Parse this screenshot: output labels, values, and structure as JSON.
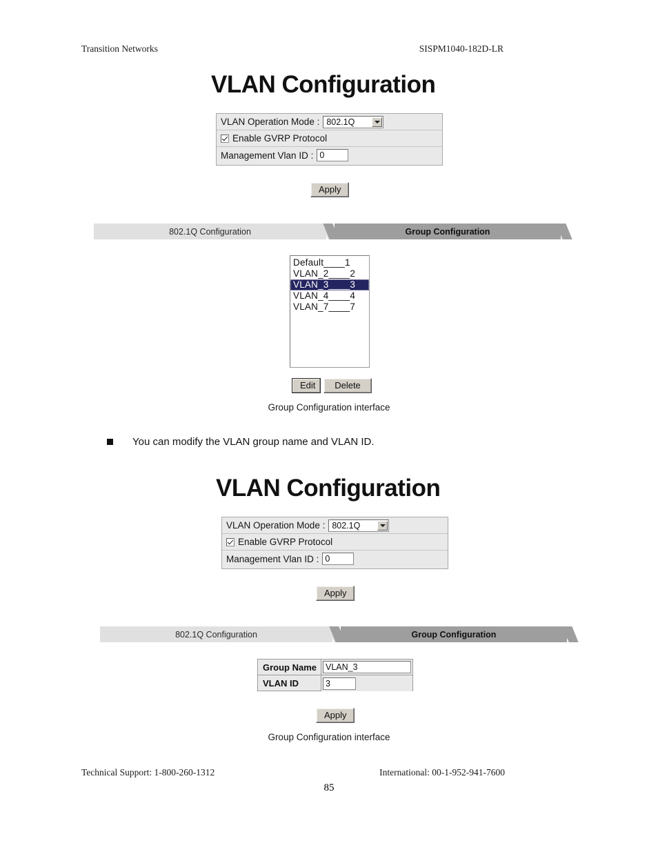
{
  "page": {
    "header_left": "Transition Networks",
    "header_right": "SISPM1040-182D-LR",
    "footer_left": "Technical Support: 1-800-260-1312",
    "footer_right": "International: 00-1-952-941-7600",
    "page_number": "85"
  },
  "note": {
    "bullet_text": "You can modify the VLAN group name and VLAN ID."
  },
  "screen1": {
    "title": "VLAN Configuration",
    "panel": {
      "mode_label": "VLAN Operation Mode :",
      "mode_value": "802.1Q",
      "gvrp_label": "Enable GVRP Protocol",
      "gvrp_checked": true,
      "mgmt_label": "Management Vlan ID :",
      "mgmt_value": "0"
    },
    "apply_label": "Apply",
    "tabs": [
      {
        "label": "802.1Q Configuration",
        "active": false
      },
      {
        "label": "Group Configuration",
        "active": true
      }
    ],
    "group_list": [
      {
        "text": "Default____1",
        "selected": false
      },
      {
        "text": "VLAN_2____2",
        "selected": false
      },
      {
        "text": "VLAN_3____3",
        "selected": true
      },
      {
        "text": "VLAN_4____4",
        "selected": false
      },
      {
        "text": "VLAN_7____7",
        "selected": false
      }
    ],
    "edit_label": "Edit",
    "delete_label": "Delete",
    "caption": "Group Configuration interface"
  },
  "screen2": {
    "title": "VLAN Configuration",
    "panel": {
      "mode_label": "VLAN Operation Mode :",
      "mode_value": "802.1Q",
      "gvrp_label": "Enable GVRP Protocol",
      "gvrp_checked": true,
      "mgmt_label": "Management Vlan ID :",
      "mgmt_value": "0"
    },
    "apply_label": "Apply",
    "tabs": [
      {
        "label": "802.1Q Configuration",
        "active": false
      },
      {
        "label": "Group Configuration",
        "active": true
      }
    ],
    "form": {
      "group_name_label": "Group Name",
      "group_name_value": "VLAN_3",
      "vlan_id_label": "VLAN ID",
      "vlan_id_value": "3"
    },
    "apply2_label": "Apply",
    "caption": "Group Configuration interface"
  },
  "colors": {
    "tab_active_bg": "#9e9e9e",
    "tab_inactive_bg": "#e0e0e0",
    "panel_bg": "#e9e9e9",
    "selection_bg": "#242460",
    "button_face": "#d4d0c8"
  }
}
